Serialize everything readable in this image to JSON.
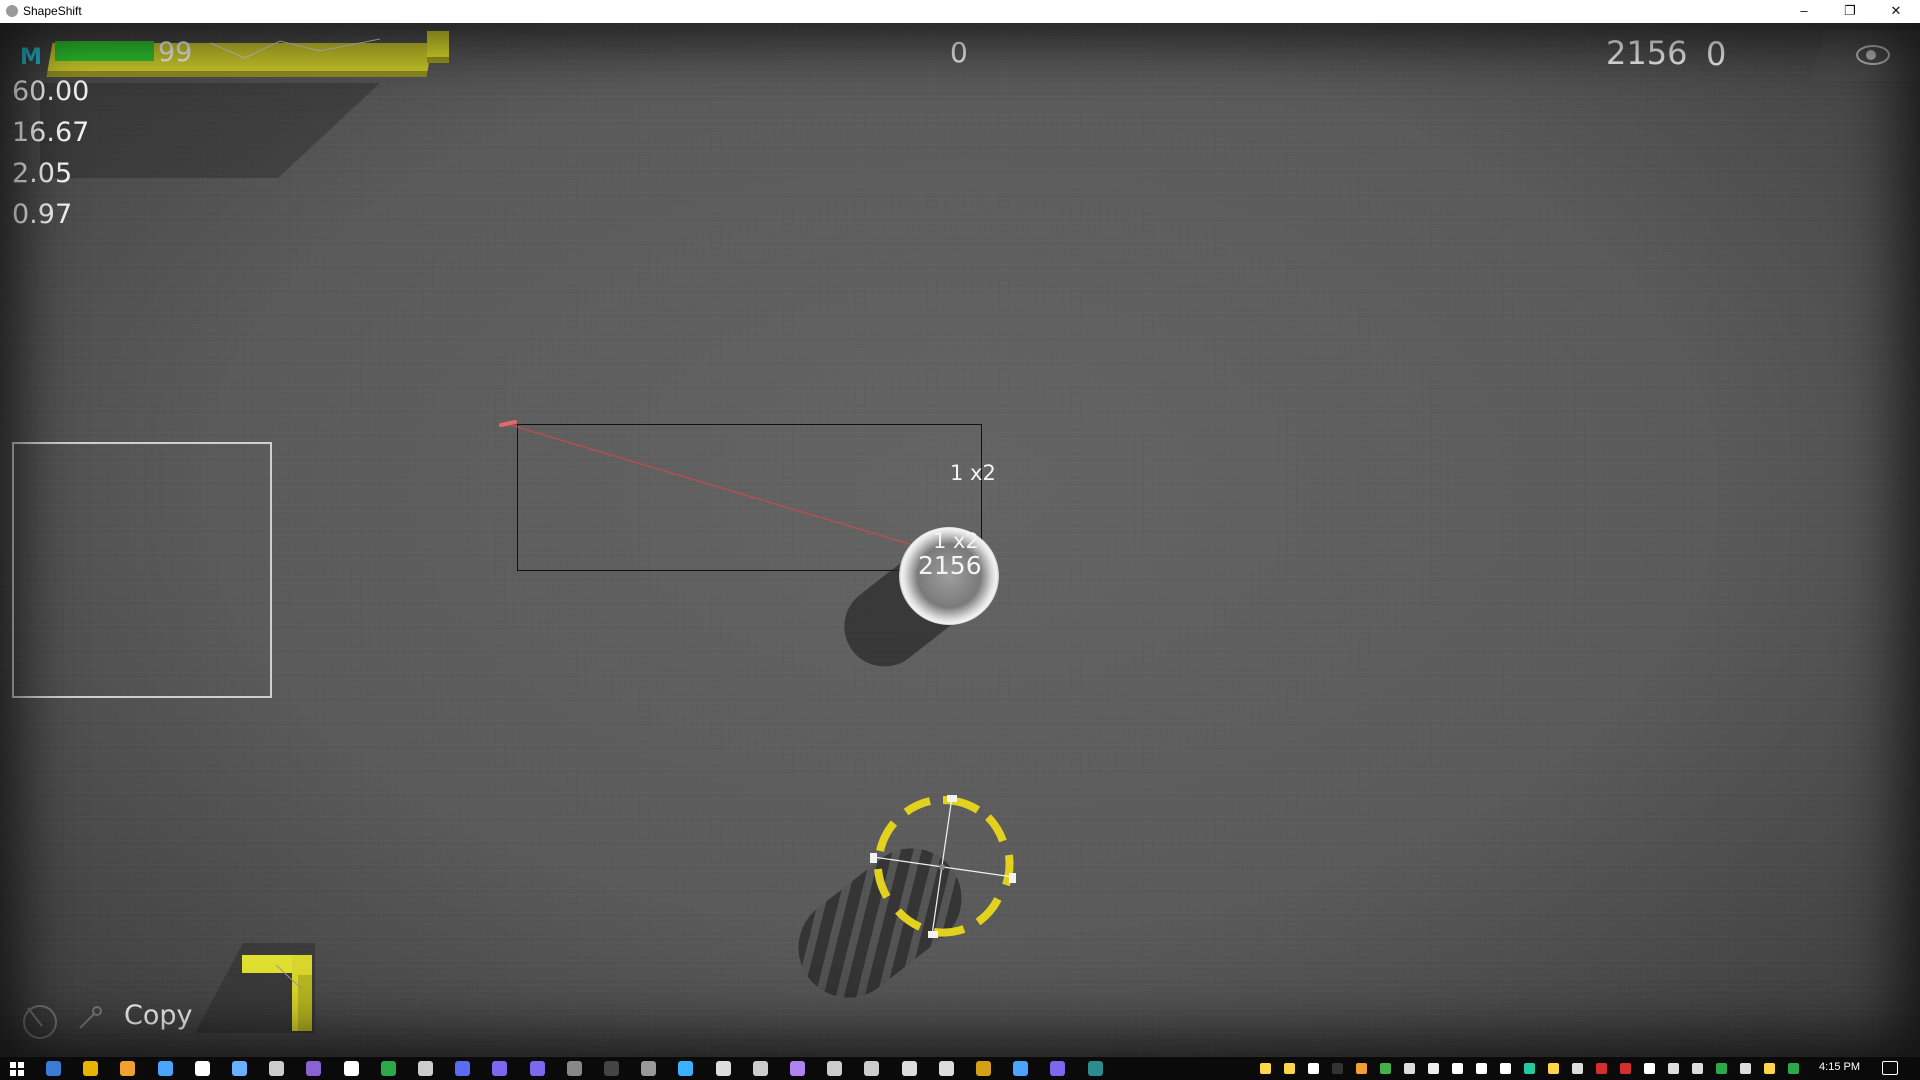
{
  "window": {
    "title": "ShapeShift",
    "minimize_glyph": "–",
    "restore_glyph": "❐",
    "close_glyph": "✕"
  },
  "hud": {
    "mana_icon": "M",
    "health_value": "99",
    "health_fraction": 0.26,
    "center_counter": "0",
    "score": "2156",
    "right_counter": "0",
    "stats": [
      "60.00",
      "16.67",
      "2.05",
      "0.97"
    ],
    "eye_icon": "eye-icon"
  },
  "world": {
    "selection_label": "1 x2",
    "enemy_label": "1 x2",
    "enemy_value": "2156"
  },
  "bottom_left": {
    "copy_label": "Copy",
    "icons": [
      "cursor-icon",
      "wrench-icon"
    ]
  },
  "taskbar": {
    "clock": "4:15 PM",
    "pinned_icon_colors": [
      "#3a7bd5",
      "#e8b400",
      "#f0a030",
      "#4aa3ff",
      "#ffffff",
      "#6ab0ff",
      "#cccccc",
      "#8a63d2",
      "#ffffff",
      "#2aa84a",
      "#cccccc",
      "#5a6cf2",
      "#7b68ee",
      "#7b68ee",
      "#888888",
      "#444444",
      "#999999",
      "#3ab0ff",
      "#dddddd",
      "#cccccc",
      "#b083f0",
      "#cccccc",
      "#cccccc",
      "#dddddd",
      "#dddddd",
      "#d4a017",
      "#4aa3ff",
      "#7b68ee",
      "#2c8c8c"
    ],
    "tray_icon_colors": [
      "#ffd54a",
      "#ffd54a",
      "#ffffff",
      "#333333",
      "#f0a030",
      "#46b04a",
      "#dddddd",
      "#eeeeee",
      "#ffffff",
      "#ffffff",
      "#ffffff",
      "#27c7a0",
      "#ffd54a",
      "#dddddd",
      "#d32f2f",
      "#d32f2f",
      "#ffffff",
      "#dddddd",
      "#dddddd",
      "#2aa84a",
      "#dddddd",
      "#ffd54a",
      "#2aa84a"
    ]
  }
}
